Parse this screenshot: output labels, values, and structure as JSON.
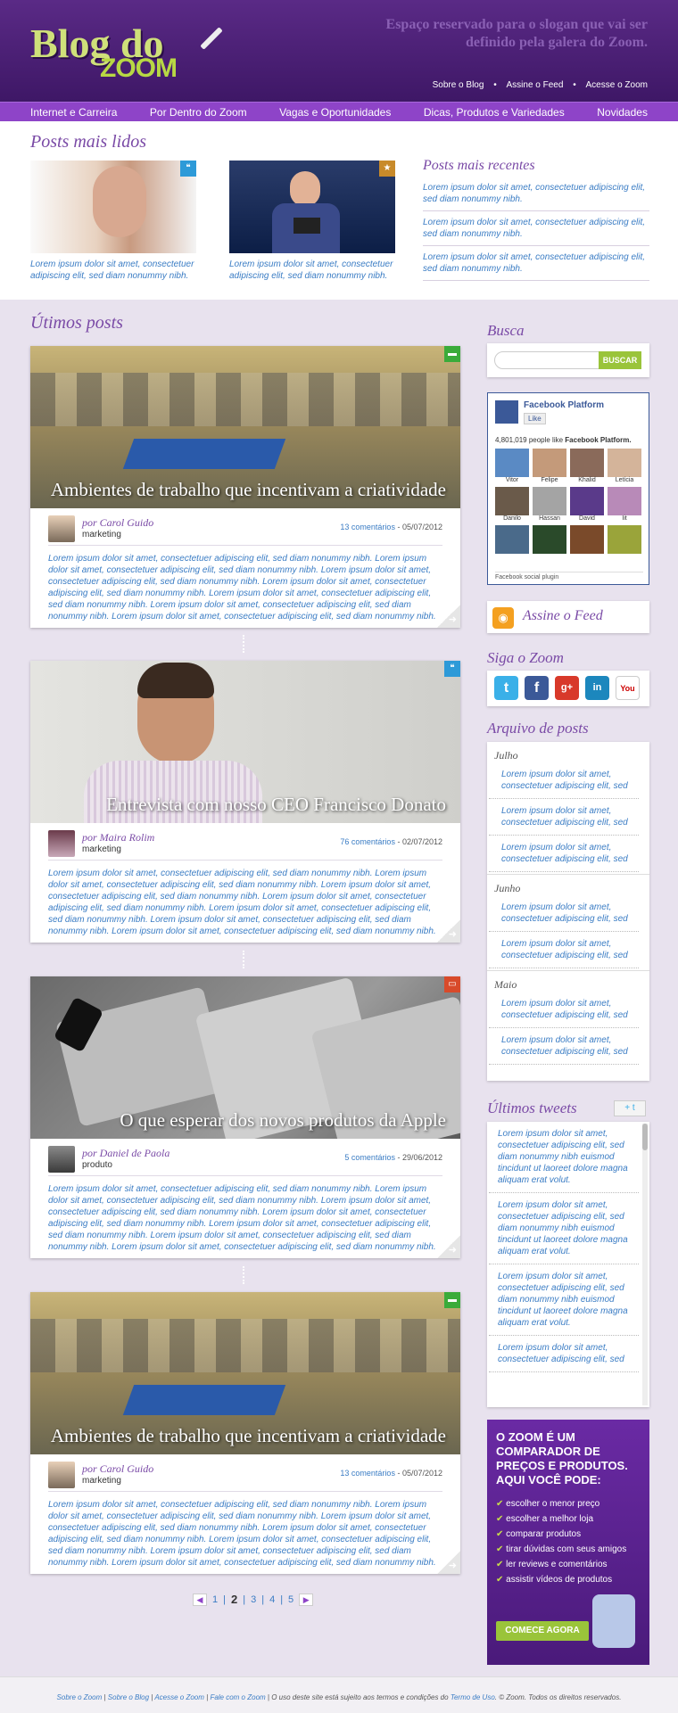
{
  "header": {
    "logo_line1": "Blog do",
    "logo_line2": "ZOOM",
    "slogan": "Espaço reservado para o slogan que vai ser definido pela galera do Zoom.",
    "links": [
      "Sobre o Blog",
      "Assine o Feed",
      "Acesse o Zoom"
    ],
    "link_sep": "•"
  },
  "nav": [
    "Internet e Carreira",
    "Por Dentro do Zoom",
    "Vagas e Oportunidades",
    "Dicas, Produtos e Variedades",
    "Novidades"
  ],
  "popular": {
    "heading": "Posts mais lidos",
    "items": [
      {
        "text": "Lorem ipsum dolor sit amet, consectetuer adipiscing elit, sed diam nonummy nibh.",
        "badge_icon": "quote-icon"
      },
      {
        "text": "Lorem ipsum dolor sit amet, consectetuer adipiscing elit, sed diam nonummy nibh.",
        "badge_icon": "star-icon"
      }
    ]
  },
  "recent": {
    "heading": "Posts mais recentes",
    "items": [
      "Lorem ipsum dolor sit amet, consectetuer adipiscing elit, sed diam nonummy nibh.",
      "Lorem ipsum dolor sit amet, consectetuer adipiscing elit, sed diam nonummy nibh.",
      "Lorem ipsum dolor sit amet, consectetuer adipiscing elit, sed diam nonummy nibh."
    ]
  },
  "latest": {
    "heading": "Útimos posts",
    "posts": [
      {
        "title": "Ambientes de trabalho que incentivam a criatividade",
        "author": "por Carol Guido",
        "category": "marketing",
        "comments": "13 comentários",
        "date": "05/07/2012",
        "badge_color": "#3aab3a"
      },
      {
        "title": "Entrevista com nosso CEO Francisco Donato",
        "author": "por Maira Rolim",
        "category": "marketing",
        "comments": "76 comentários",
        "date": "02/07/2012",
        "badge_color": "#2d9ad8"
      },
      {
        "title": "O que esperar dos novos produtos da Apple",
        "author": "por Daniel de Paola",
        "category": "produto",
        "comments": "5 comentários",
        "date": "29/06/2012",
        "badge_color": "#d84a2a"
      },
      {
        "title": "Ambientes de trabalho que incentivam a criatividade",
        "author": "por Carol Guido",
        "category": "marketing",
        "comments": "13 comentários",
        "date": "05/07/2012",
        "badge_color": "#3aab3a"
      }
    ],
    "body": "Lorem ipsum dolor sit amet, consectetuer adipiscing elit, sed diam nonummy nibh. Lorem ipsum dolor sit amet, consectetuer adipiscing elit, sed diam nonummy nibh. Lorem ipsum dolor sit amet, consectetuer adipiscing elit, sed diam nonummy nibh. Lorem ipsum dolor sit amet, consectetuer adipiscing elit, sed diam nonummy nibh. Lorem ipsum dolor sit amet, consectetuer adipiscing elit, sed diam nonummy nibh. Lorem ipsum dolor sit amet, consectetuer adipiscing elit, sed diam nonummy nibh. Lorem ipsum dolor sit amet, consectetuer adipiscing elit, sed diam nonummy nibh."
  },
  "pagination": {
    "pages": [
      "1",
      "2",
      "3",
      "4",
      "5"
    ],
    "current": "2",
    "sep": "|"
  },
  "sidebar": {
    "search_title": "Busca",
    "search_button": "BUSCAR",
    "facebook": {
      "name": "Facebook Platform",
      "like": "Like",
      "count": "4,801,019 people like",
      "bold": "Facebook Platform.",
      "people": [
        "Vitor",
        "Felipe",
        "Khalid",
        "Letícia",
        "Danilo",
        "Hassan",
        "David",
        "Iit"
      ],
      "plugin": "Facebook social plugin"
    },
    "feed": "Assine o Feed",
    "follow_title": "Siga o Zoom",
    "archive_title": "Arquivo de posts",
    "archive": [
      {
        "month": "Julho",
        "items": [
          "Lorem ipsum dolor sit amet, consectetuer adipiscing elit, sed",
          "Lorem ipsum dolor sit amet, consectetuer adipiscing elit, sed",
          "Lorem ipsum dolor sit amet, consectetuer adipiscing elit, sed"
        ]
      },
      {
        "month": "Junho",
        "items": [
          "Lorem ipsum dolor sit amet, consectetuer adipiscing elit, sed",
          "Lorem ipsum dolor sit amet, consectetuer adipiscing elit, sed"
        ]
      },
      {
        "month": "Maio",
        "items": [
          "Lorem ipsum dolor sit amet, consectetuer adipiscing elit, sed",
          "Lorem ipsum dolor sit amet, consectetuer adipiscing elit, sed"
        ]
      }
    ],
    "tweets_title": "Últimos tweets",
    "tweets": [
      "Lorem ipsum dolor sit amet, consectetuer adipiscing elit, sed diam nonummy nibh euismod tincidunt ut laoreet dolore magna aliquam erat volut.",
      "Lorem ipsum dolor sit amet, consectetuer adipiscing elit, sed diam nonummy nibh euismod tincidunt ut laoreet dolore magna aliquam erat volut.",
      "Lorem ipsum dolor sit amet, consectetuer adipiscing elit, sed diam nonummy nibh euismod tincidunt ut laoreet dolore magna aliquam erat volut.",
      "Lorem ipsum dolor sit amet, consectetuer adipiscing elit, sed"
    ],
    "ad": {
      "headline": "O ZOOM É UM COMPARADOR DE PREÇOS E PRODUTOS. AQUI VOCÊ PODE:",
      "items": [
        "escolher o menor preço",
        "escolher a melhor loja",
        "comparar produtos",
        "tirar dúvidas com seus amigos",
        "ler reviews e comentários",
        "assistir vídeos de produtos"
      ],
      "button": "COMECE AGORA"
    }
  },
  "footer": {
    "links": [
      "Sobre o Zoom",
      "Sobre o Blog",
      "Acesse o Zoom",
      "Fale com o Zoom"
    ],
    "sep": "|",
    "text_before": "O uso deste site está sujeito aos termos e condições do",
    "terms": "Termo de Uso",
    "text_after": ". © Zoom. Todos os direitos reservados."
  }
}
